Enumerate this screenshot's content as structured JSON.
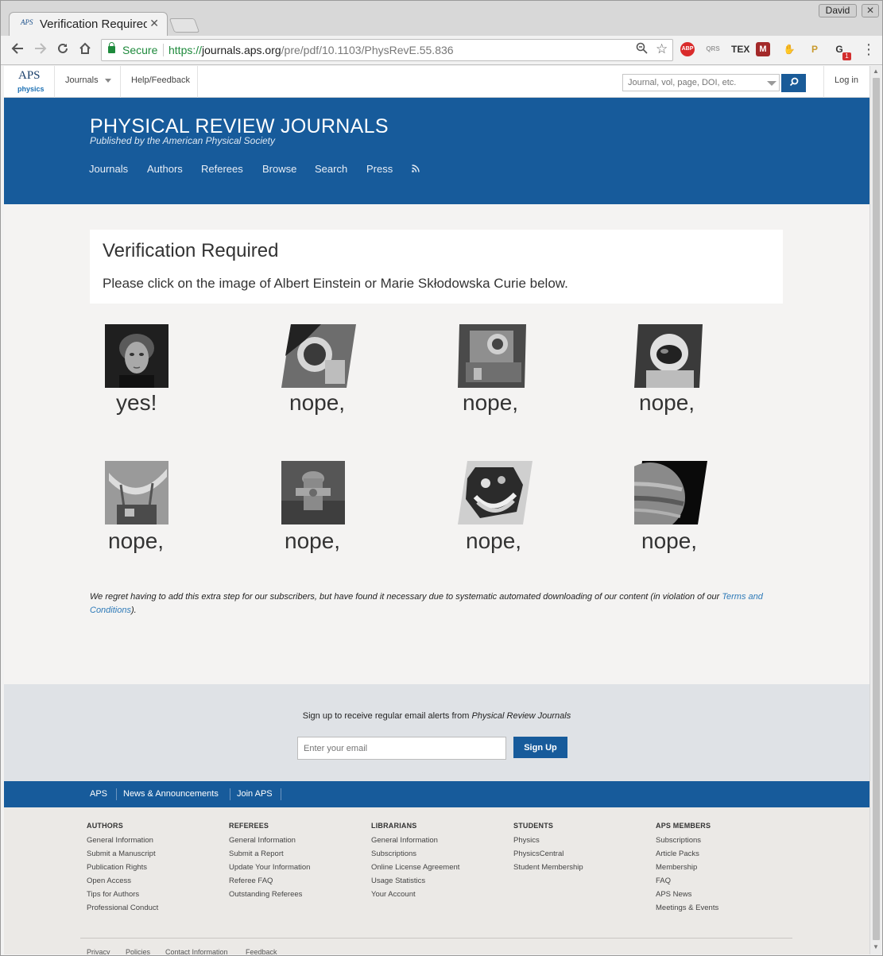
{
  "browser": {
    "tab_title": "Verification Required",
    "tab_favicon": "APS",
    "tab_close": "✕",
    "profile_name": "David",
    "window_close": "✕",
    "security_label": "Secure",
    "url_scheme": "https://",
    "url_host": "journals.aps.org",
    "url_path": "/pre/pdf/10.1103/PhysRevE.55.836",
    "extensions": [
      {
        "name": "adblock-plus",
        "label": "ABP",
        "color": "#d92b2b"
      },
      {
        "name": "qrs",
        "label": "QRS",
        "color": "#9a9a9a"
      },
      {
        "name": "tex",
        "label": "TEX",
        "color": "#333333"
      },
      {
        "name": "mendeley",
        "label": "M",
        "color": "#a32929"
      },
      {
        "name": "gnome",
        "label": "✋",
        "color": "#222222"
      },
      {
        "name": "penguin",
        "label": "P",
        "color": "#c99a2e"
      },
      {
        "name": "ghostery",
        "label": "G",
        "color": "#333333"
      }
    ],
    "extension_badge": "1"
  },
  "topnav": {
    "logo_main": "APS",
    "logo_sub": "physics",
    "journals": "Journals",
    "help": "Help/Feedback",
    "search_placeholder": "Journal, vol, page, DOI, etc.",
    "login": "Log in"
  },
  "banner": {
    "title": "PHYSICAL REVIEW JOURNALS",
    "subtitle": "Published by the American Physical Society",
    "nav": [
      "Journals",
      "Authors",
      "Referees",
      "Browse",
      "Search",
      "Press"
    ]
  },
  "verification": {
    "title": "Verification Required",
    "instruction": "Please click on the image of Albert Einstein or Marie Skłodowska Curie below."
  },
  "choices": [
    {
      "subject": "portrait-woman",
      "caption": "yes!"
    },
    {
      "subject": "astronaut-close",
      "caption": "nope,"
    },
    {
      "subject": "lunar-lander",
      "caption": "nope,"
    },
    {
      "subject": "astronaut-helmet",
      "caption": "nope,"
    },
    {
      "subject": "radio-dish",
      "caption": "nope,"
    },
    {
      "subject": "fire-hydrant",
      "caption": "nope,"
    },
    {
      "subject": "fruit-plate",
      "caption": "nope,"
    },
    {
      "subject": "jupiter",
      "caption": "nope,"
    }
  ],
  "regret": {
    "text": "We regret having to add this extra step for our subscribers, but have found it necessary due to systematic automated downloading of our content (in violation of our ",
    "link": "Terms and Conditions",
    "end": ")."
  },
  "signup": {
    "text_prefix": "Sign up to receive regular email alerts from ",
    "text_journal": "Physical Review Journals",
    "email_placeholder": "Enter your email",
    "button": "Sign Up"
  },
  "footbar": [
    "APS",
    "News & Announcements",
    "Join APS"
  ],
  "footer": {
    "columns": [
      {
        "heading": "AUTHORS",
        "items": [
          "General Information",
          "Submit a Manuscript",
          "Publication Rights",
          "Open Access",
          "Tips for Authors",
          "Professional Conduct"
        ]
      },
      {
        "heading": "REFEREES",
        "items": [
          "General Information",
          "Submit a Report",
          "Update Your Information",
          "Referee FAQ",
          "Outstanding Referees"
        ]
      },
      {
        "heading": "LIBRARIANS",
        "items": [
          "General Information",
          "Subscriptions",
          "Online License Agreement",
          "Usage Statistics",
          "Your Account"
        ]
      },
      {
        "heading": "STUDENTS",
        "items": [
          "Physics",
          "PhysicsCentral",
          "Student Membership"
        ]
      },
      {
        "heading": "APS MEMBERS",
        "items": [
          "Subscriptions",
          "Article Packs",
          "Membership",
          "FAQ",
          "APS News",
          "Meetings & Events"
        ]
      }
    ],
    "legal": [
      "Privacy",
      "Policies",
      "Contact Information",
      "Feedback"
    ]
  },
  "colors": {
    "brand_blue": "#175b9b",
    "link_blue": "#2e7ab8",
    "secure_green": "#1e8a3c"
  }
}
